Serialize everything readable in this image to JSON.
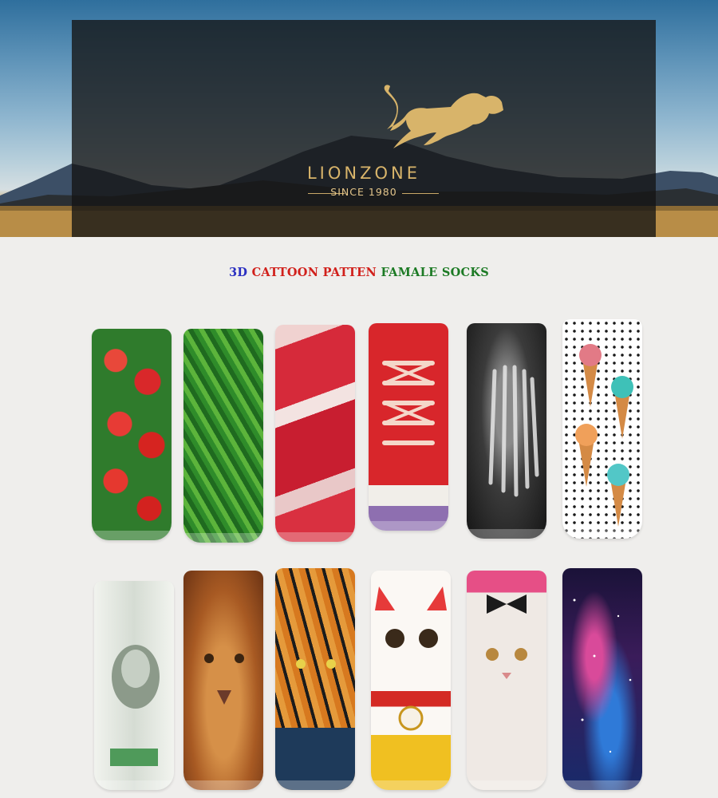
{
  "brand": {
    "name": "LIONZONE",
    "since": "SINCE 1980"
  },
  "headline": {
    "part_3d": "3D",
    "part_red": "CATTOON PATTEN",
    "part_green": "FAMALE SOCKS"
  },
  "socks": [
    {
      "design": "strawberry"
    },
    {
      "design": "green-leaves"
    },
    {
      "design": "raw-meat"
    },
    {
      "design": "red-sneaker"
    },
    {
      "design": "foot-x-ray"
    },
    {
      "design": "ice-cream-cones"
    },
    {
      "design": "dollar-bill"
    },
    {
      "design": "lion-face"
    },
    {
      "design": "tiger-face"
    },
    {
      "design": "lucky-cat"
    },
    {
      "design": "white-cat-bow"
    },
    {
      "design": "galaxy"
    }
  ],
  "colors": {
    "brand_gold": "#d8b46a",
    "headline_blue": "#2a2fc1",
    "headline_red": "#d1201b",
    "headline_green": "#1c7a24"
  }
}
